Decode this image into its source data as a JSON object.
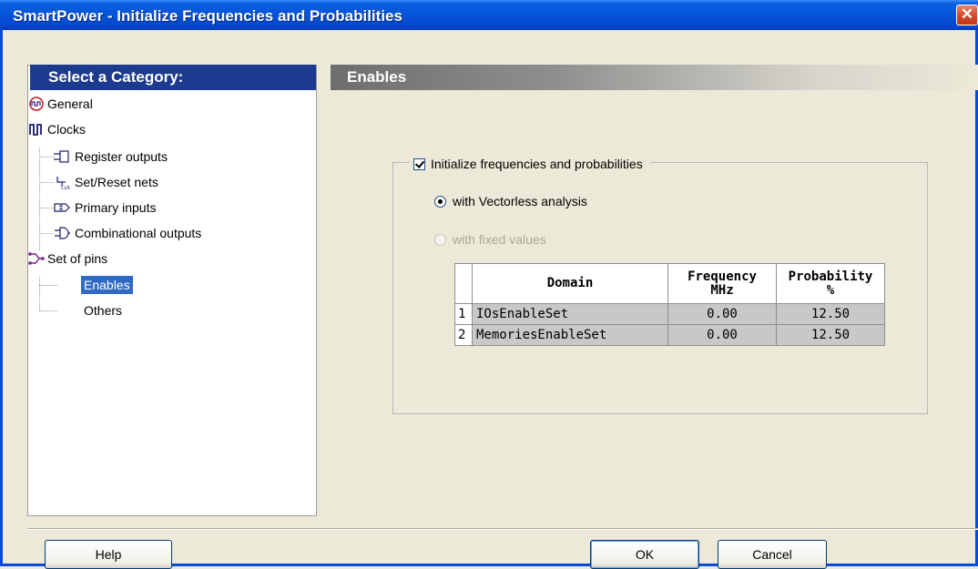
{
  "window": {
    "title": "SmartPower - Initialize Frequencies and Probabilities",
    "close_glyph": "✕"
  },
  "sidebar": {
    "header": "Select a Category:",
    "items": [
      {
        "label": "General",
        "icon": "general-icon"
      },
      {
        "label": "Clocks",
        "icon": "clocks-icon"
      },
      {
        "label": "Register outputs",
        "icon": "register-icon"
      },
      {
        "label": "Set/Reset nets",
        "icon": "setreset-icon"
      },
      {
        "label": "Primary inputs",
        "icon": "input-icon"
      },
      {
        "label": "Combinational outputs",
        "icon": "combinational-icon"
      },
      {
        "label": "Set of pins",
        "icon": "pins-icon"
      },
      {
        "label": "Enables",
        "selected": true
      },
      {
        "label": "Others"
      }
    ]
  },
  "main": {
    "header": "Enables",
    "init_checkbox": {
      "label": "Initialize frequencies and probabilities",
      "checked": true
    },
    "radio_vectorless": {
      "label": "with Vectorless analysis",
      "selected": true
    },
    "radio_fixed": {
      "label": "with fixed values",
      "selected": false,
      "disabled": true
    },
    "table": {
      "headers": {
        "domain": "Domain",
        "freq_line1": "Frequency",
        "freq_line2": "MHz",
        "prob_line1": "Probability",
        "prob_line2": "%"
      },
      "rows": [
        {
          "num": "1",
          "domain": "IOsEnableSet",
          "frequency": "0.00",
          "probability": "12.50"
        },
        {
          "num": "2",
          "domain": "MemoriesEnableSet",
          "frequency": "0.00",
          "probability": "12.50"
        }
      ]
    }
  },
  "buttons": {
    "help": "Help",
    "ok": "OK",
    "cancel": "Cancel"
  },
  "colors": {
    "title_bar": "#0453d8",
    "category_header": "#1c3b8e",
    "selection": "#316ac5",
    "dialog_bg": "#ece9d8"
  }
}
